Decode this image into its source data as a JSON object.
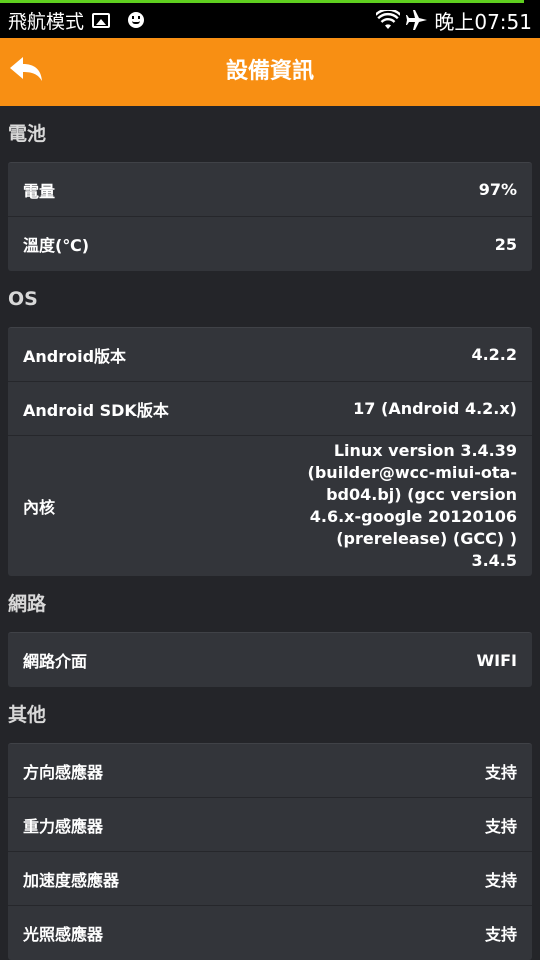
{
  "statusbar": {
    "progress_fraction": 0.97,
    "airplane_text": "飛航模式",
    "time": "晚上07:51",
    "icons": [
      "image-icon",
      "smiley-icon",
      "wifi-icon",
      "airplane-icon"
    ]
  },
  "header": {
    "title": "設備資訊",
    "back_icon": "back-arrow-icon",
    "color": "#f88f13"
  },
  "sections": {
    "battery": {
      "title": "電池",
      "rows": [
        {
          "label": "電量",
          "value": "97%"
        },
        {
          "label": "溫度(℃)",
          "value": "25"
        }
      ]
    },
    "os": {
      "title": "OS",
      "rows": [
        {
          "label": "Android版本",
          "value": "4.2.2"
        },
        {
          "label": "Android SDK版本",
          "value": "17  (Android 4.2.x)"
        },
        {
          "label": "內核",
          "value": "Linux version 3.4.39 (builder@wcc-miui-ota-bd04.bj) (gcc version 4.6.x-google 20120106 (prerelease) (GCC) ) 3.4.5"
        }
      ]
    },
    "network": {
      "title": "網路",
      "rows": [
        {
          "label": "網路介面",
          "value": "WIFI"
        }
      ]
    },
    "other": {
      "title": "其他",
      "rows": [
        {
          "label": "方向感應器",
          "value": "支持"
        },
        {
          "label": "重力感應器",
          "value": "支持"
        },
        {
          "label": "加速度感應器",
          "value": "支持"
        },
        {
          "label": "光照感應器",
          "value": "支持"
        }
      ]
    }
  }
}
